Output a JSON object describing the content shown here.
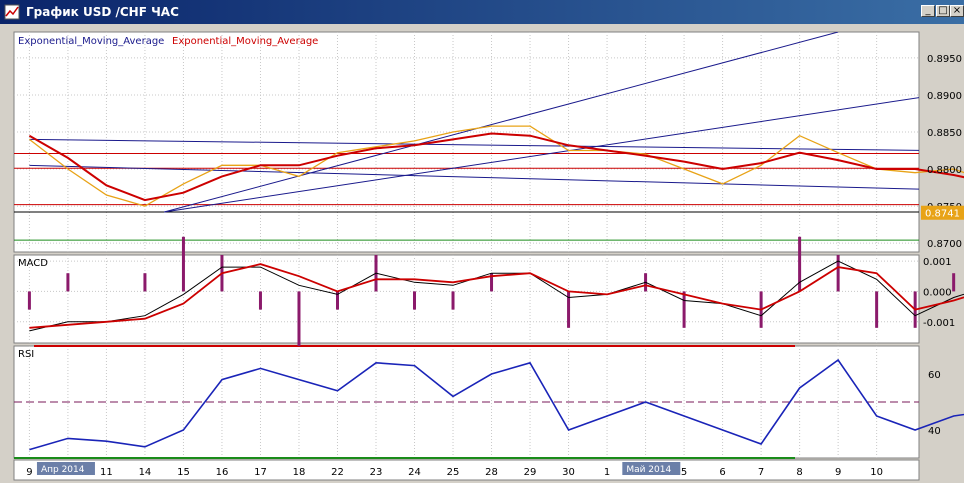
{
  "window": {
    "title": "График USD /CHF ЧАС"
  },
  "legend": {
    "ema_1": "Exponential_Moving_Average",
    "ema_2": "Exponential_Moving_Average"
  },
  "colors": {
    "price": "#e8a317",
    "ema": "#cc0000",
    "trend": "#1a1a8c",
    "rsi": "#1a24b8",
    "level_red": "#cc0000",
    "level_green": "#1a8c1a"
  },
  "chart_data": [
    {
      "type": "line",
      "pane": "price",
      "y_ticks": [
        "0.8950",
        "0.8900",
        "0.8850",
        "0.8800",
        "0.8750",
        "0.8700"
      ],
      "ylim": [
        0.8688,
        0.8985
      ],
      "last_price": "0.8741",
      "horizontal_levels": [
        {
          "value": 0.8821,
          "color": "red"
        },
        {
          "value": 0.8801,
          "color": "red"
        },
        {
          "value": 0.8752,
          "color": "red"
        },
        {
          "value": 0.8742,
          "color": "black"
        },
        {
          "value": 0.8704,
          "color": "green"
        }
      ],
      "x": [
        9,
        10,
        11,
        12,
        13,
        14,
        15,
        16,
        17,
        18,
        19,
        20,
        21,
        22,
        23,
        24,
        25,
        26,
        27,
        28,
        29,
        30,
        31,
        32,
        33,
        34,
        35,
        36,
        37
      ],
      "series": [
        {
          "name": "Exponential_Moving_Average",
          "values": [
            0.8845,
            0.8815,
            0.8778,
            0.8758,
            0.8768,
            0.879,
            0.8805,
            0.8805,
            0.8818,
            0.8828,
            0.8832,
            0.884,
            0.8848,
            0.8845,
            0.8832,
            0.8825,
            0.8818,
            0.881,
            0.88,
            0.8808,
            0.8822,
            0.8812,
            0.88,
            0.88,
            0.8792,
            0.8781,
            0.8781,
            0.8772,
            0.8761
          ]
        },
        {
          "name": "price",
          "values": [
            0.884,
            0.88,
            0.8765,
            0.875,
            0.878,
            0.8805,
            0.8805,
            0.879,
            0.8822,
            0.883,
            0.8838,
            0.885,
            0.8858,
            0.8858,
            0.8825,
            0.8825,
            0.882,
            0.88,
            0.878,
            0.8805,
            0.8845,
            0.8822,
            0.88,
            0.8795,
            0.88,
            0.8782,
            0.878,
            0.8742,
            0.8741
          ]
        }
      ],
      "trendlines": [
        {
          "from": [
            12.5,
            0.8742
          ],
          "to": [
            30,
            0.8985
          ]
        },
        {
          "from": [
            12.5,
            0.8742
          ],
          "to": [
            37,
            0.8935
          ]
        },
        {
          "from": [
            9,
            0.884
          ],
          "to": [
            37,
            0.8822
          ]
        },
        {
          "from": [
            9,
            0.8805
          ],
          "to": [
            37,
            0.8766
          ]
        }
      ]
    },
    {
      "type": "line",
      "pane": "macd",
      "title": "MACD",
      "y_ticks": [
        "0.001",
        "0.000",
        "-0.001"
      ],
      "ylim": [
        -0.0017,
        0.0012
      ],
      "x": [
        9,
        10,
        11,
        12,
        13,
        14,
        15,
        16,
        17,
        18,
        19,
        20,
        21,
        22,
        23,
        24,
        25,
        26,
        27,
        28,
        29,
        30,
        31,
        32,
        33,
        34,
        35,
        36,
        37
      ],
      "series": [
        {
          "name": "macd",
          "values": [
            -0.0013,
            -0.001,
            -0.001,
            -0.0008,
            -0.0001,
            0.0008,
            0.0008,
            0.0002,
            -0.0001,
            0.0006,
            0.0003,
            0.0002,
            0.0006,
            0.0006,
            -0.0002,
            -0.0001,
            0.0003,
            -0.0003,
            -0.0004,
            -0.0008,
            0.0003,
            0.001,
            0.0004,
            -0.0008,
            -0.0002,
            0.0002,
            -0.0009,
            -0.0012,
            -0.0009
          ]
        },
        {
          "name": "signal",
          "values": [
            -0.0012,
            -0.0011,
            -0.001,
            -0.0009,
            -0.0004,
            0.0006,
            0.0009,
            0.0005,
            0.0,
            0.0004,
            0.0004,
            0.0003,
            0.0005,
            0.0006,
            0.0,
            -0.0001,
            0.0002,
            -0.0001,
            -0.0004,
            -0.0006,
            0.0,
            0.0008,
            0.0006,
            -0.0006,
            -0.0003,
            0.0001,
            -0.0007,
            -0.0012,
            -0.0008
          ]
        }
      ]
    },
    {
      "type": "line",
      "pane": "rsi",
      "title": "RSI",
      "y_ticks": [
        "60",
        "40"
      ],
      "ylim": [
        30,
        70
      ],
      "levels": [
        70,
        50,
        30
      ],
      "x": [
        9,
        10,
        11,
        12,
        13,
        14,
        15,
        16,
        17,
        18,
        19,
        20,
        21,
        22,
        23,
        24,
        25,
        26,
        27,
        28,
        29,
        30,
        31,
        32,
        33,
        34,
        35,
        36,
        37
      ],
      "series": [
        {
          "name": "rsi",
          "values": [
            33,
            37,
            36,
            34,
            40,
            58,
            62,
            58,
            54,
            64,
            63,
            52,
            60,
            64,
            40,
            45,
            50,
            45,
            40,
            35,
            55,
            65,
            45,
            40,
            45,
            47,
            44,
            32,
            40
          ]
        }
      ],
      "x_labels": [
        {
          "x": 9,
          "label": "9"
        },
        {
          "x": 10,
          "label": "10"
        },
        {
          "x": 11,
          "label": "11"
        },
        {
          "x": 12,
          "label": "14"
        },
        {
          "x": 13,
          "label": "15"
        },
        {
          "x": 14,
          "label": "16"
        },
        {
          "x": 15,
          "label": "17"
        },
        {
          "x": 16,
          "label": "18"
        },
        {
          "x": 17,
          "label": "22"
        },
        {
          "x": 18,
          "label": "23"
        },
        {
          "x": 19,
          "label": "24"
        },
        {
          "x": 20,
          "label": "25"
        },
        {
          "x": 21,
          "label": "28"
        },
        {
          "x": 22,
          "label": "29"
        },
        {
          "x": 23,
          "label": "30"
        },
        {
          "x": 24,
          "label": "1"
        },
        {
          "x": 25,
          "label": "2"
        },
        {
          "x": 26,
          "label": "5"
        },
        {
          "x": 27,
          "label": "6"
        },
        {
          "x": 28,
          "label": "7"
        },
        {
          "x": 29,
          "label": "8"
        },
        {
          "x": 30,
          "label": "9"
        },
        {
          "x": 31,
          "label": "10"
        }
      ],
      "month_labels": [
        {
          "x": 9.3,
          "label": "Апр 2014"
        },
        {
          "x": 24.5,
          "label": "Май 2014"
        }
      ]
    }
  ]
}
